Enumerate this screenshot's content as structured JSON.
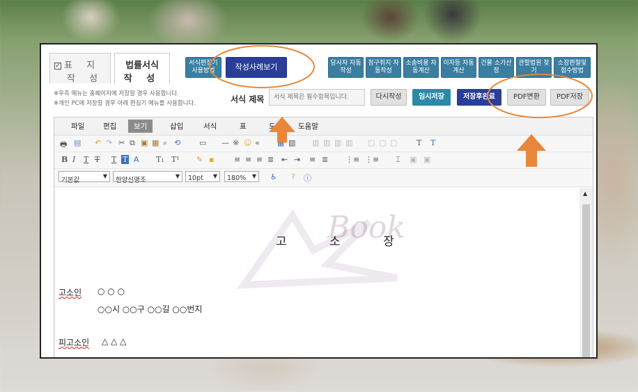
{
  "tabs": {
    "cover": {
      "line1": "표 지",
      "line2": "작 성"
    },
    "legal": {
      "line1": "법률서식",
      "line2": "작 성"
    }
  },
  "header_buttons": {
    "editor_usage": "서식편집기 사용방법",
    "example_view": "작성사례보기",
    "party_auto": "당사자 자동작성",
    "claim_auto": "청구취지 자동작성",
    "litigation_cost": "소송비용 자동계산",
    "interest_calc": "이자등 자동계산",
    "building_calc": "건물 소가산정",
    "court_find": "관할법원 찾기",
    "complaint_app": "소장편철및 접수방법"
  },
  "notes": {
    "line1": "※우측 메뉴는 홈페이지에 저장할 경우 사용합니다.",
    "line2": "※개인 PC에 저장할 경우 아래 편집기 메뉴를 사용합니다."
  },
  "title_field": {
    "label": "서식 제목",
    "placeholder": "서식 제목은 필수항목입니다."
  },
  "action_buttons": {
    "rewrite": "다시작성",
    "temp_save": "임시저장",
    "save_finish": "저장후완료",
    "pdf_convert": "PDF변환",
    "pdf_save": "PDF저장"
  },
  "menu": {
    "file": "파일",
    "edit": "편집",
    "view": "보기",
    "insert": "삽입",
    "format": "서식",
    "table": "표",
    "tools": "도구",
    "help": "도움말"
  },
  "font_controls": {
    "style": "기본값",
    "font": "한양신명조",
    "size": "10pt",
    "zoom": "180%"
  },
  "document": {
    "title": "고 소 장",
    "complainant_label": "고소인",
    "complainant_name": "○ ○ ○",
    "complainant_address": "○○시 ○○구 ○○길 ○○번지",
    "accused_label": "피고소인",
    "accused_name": "△ △ △",
    "watermark": "Book"
  },
  "colors": {
    "teal": "#3a7fa1",
    "navy": "#2a3e99",
    "annotation_orange": "#e8873a"
  }
}
